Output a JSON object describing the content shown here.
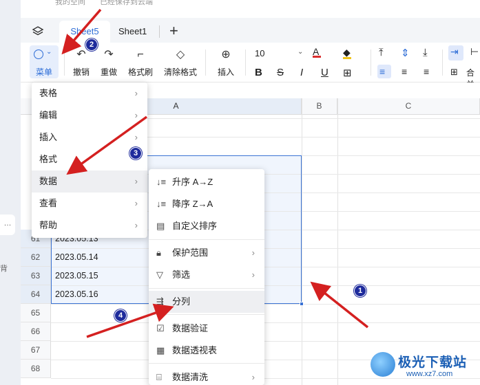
{
  "title_row": {
    "a": "我的空间",
    "b": "已经保存到云端"
  },
  "tabs": {
    "active": "Sheet5",
    "other": "Sheet1",
    "add": "+"
  },
  "toolbar": {
    "menu": "菜单",
    "undo": "撤销",
    "redo": "重做",
    "format_painter": "格式刷",
    "clear_format": "清除格式",
    "insert": "插入",
    "font_size": "10",
    "merge": "合并"
  },
  "columns": [
    "A",
    "B",
    "C"
  ],
  "rows": [
    {
      "num": "61",
      "value": "2023.05.13"
    },
    {
      "num": "62",
      "value": "2023.05.14"
    },
    {
      "num": "63",
      "value": "2023.05.15"
    },
    {
      "num": "64",
      "value": "2023.05.16"
    },
    {
      "num": "65",
      "value": ""
    },
    {
      "num": "66",
      "value": ""
    },
    {
      "num": "67",
      "value": ""
    },
    {
      "num": "68",
      "value": ""
    }
  ],
  "menu": {
    "items": [
      {
        "label": "表格",
        "arrow": "›"
      },
      {
        "label": "编辑",
        "arrow": "›"
      },
      {
        "label": "插入",
        "arrow": "›"
      },
      {
        "label": "格式",
        "arrow": ""
      },
      {
        "label": "数据",
        "arrow": "›"
      },
      {
        "label": "查看",
        "arrow": "›"
      },
      {
        "label": "帮助",
        "arrow": "›"
      }
    ]
  },
  "submenu": {
    "items": [
      {
        "label": "升序 A→Z",
        "icon": "sort-asc-icon"
      },
      {
        "label": "降序 Z→A",
        "icon": "sort-desc-icon"
      },
      {
        "label": "自定义排序",
        "icon": "custom-sort-icon"
      },
      {
        "label": "保护范围",
        "icon": "lock-icon",
        "arrow": "›"
      },
      {
        "label": "筛选",
        "icon": "filter-icon",
        "arrow": "›"
      },
      {
        "label": "分列",
        "icon": "split-column-icon"
      },
      {
        "label": "数据验证",
        "icon": "validation-icon"
      },
      {
        "label": "数据透视表",
        "icon": "pivot-table-icon"
      },
      {
        "label": "数据清洗",
        "icon": "data-clean-icon",
        "arrow": "›"
      }
    ]
  },
  "markers": [
    "1",
    "2",
    "3",
    "4"
  ],
  "sidebar": {
    "dots": "…",
    "char": "背"
  },
  "watermark": {
    "name": "极光下载站",
    "url": "www.xz7.com"
  },
  "colors": {
    "accent": "#2c6cd6",
    "arrow": "#d42020",
    "marker": "#1e2b9c"
  }
}
